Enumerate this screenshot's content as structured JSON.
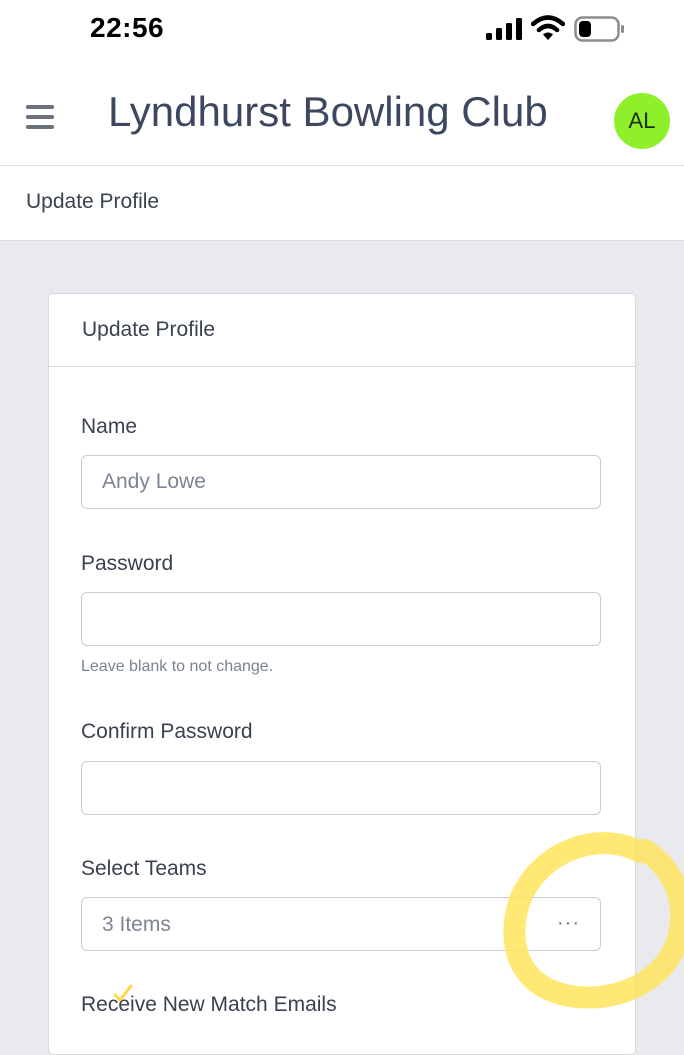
{
  "status_bar": {
    "time": "22:56",
    "icons": [
      "signal-icon",
      "wifi-icon",
      "battery-icon"
    ]
  },
  "header": {
    "menu_icon": "hamburger-menu-icon",
    "title": "Lyndhurst Bowling Club",
    "avatar_initials": "AL",
    "avatar_color": "#8ef02a"
  },
  "breadcrumb": "Update Profile",
  "form": {
    "card_title": "Update Profile",
    "name": {
      "label": "Name",
      "value": "Andy Lowe"
    },
    "password": {
      "label": "Password",
      "value": "",
      "hint": "Leave blank to not change."
    },
    "confirm_password": {
      "label": "Confirm Password",
      "value": ""
    },
    "teams": {
      "label": "Select Teams",
      "value": "3 Items",
      "more": "···"
    },
    "match_emails": {
      "label": "Receive New Match Emails"
    }
  },
  "colors": {
    "accent_text": "#3c4860",
    "page_background": "#e8eaed",
    "highlight_marker": "#ffe45c"
  }
}
